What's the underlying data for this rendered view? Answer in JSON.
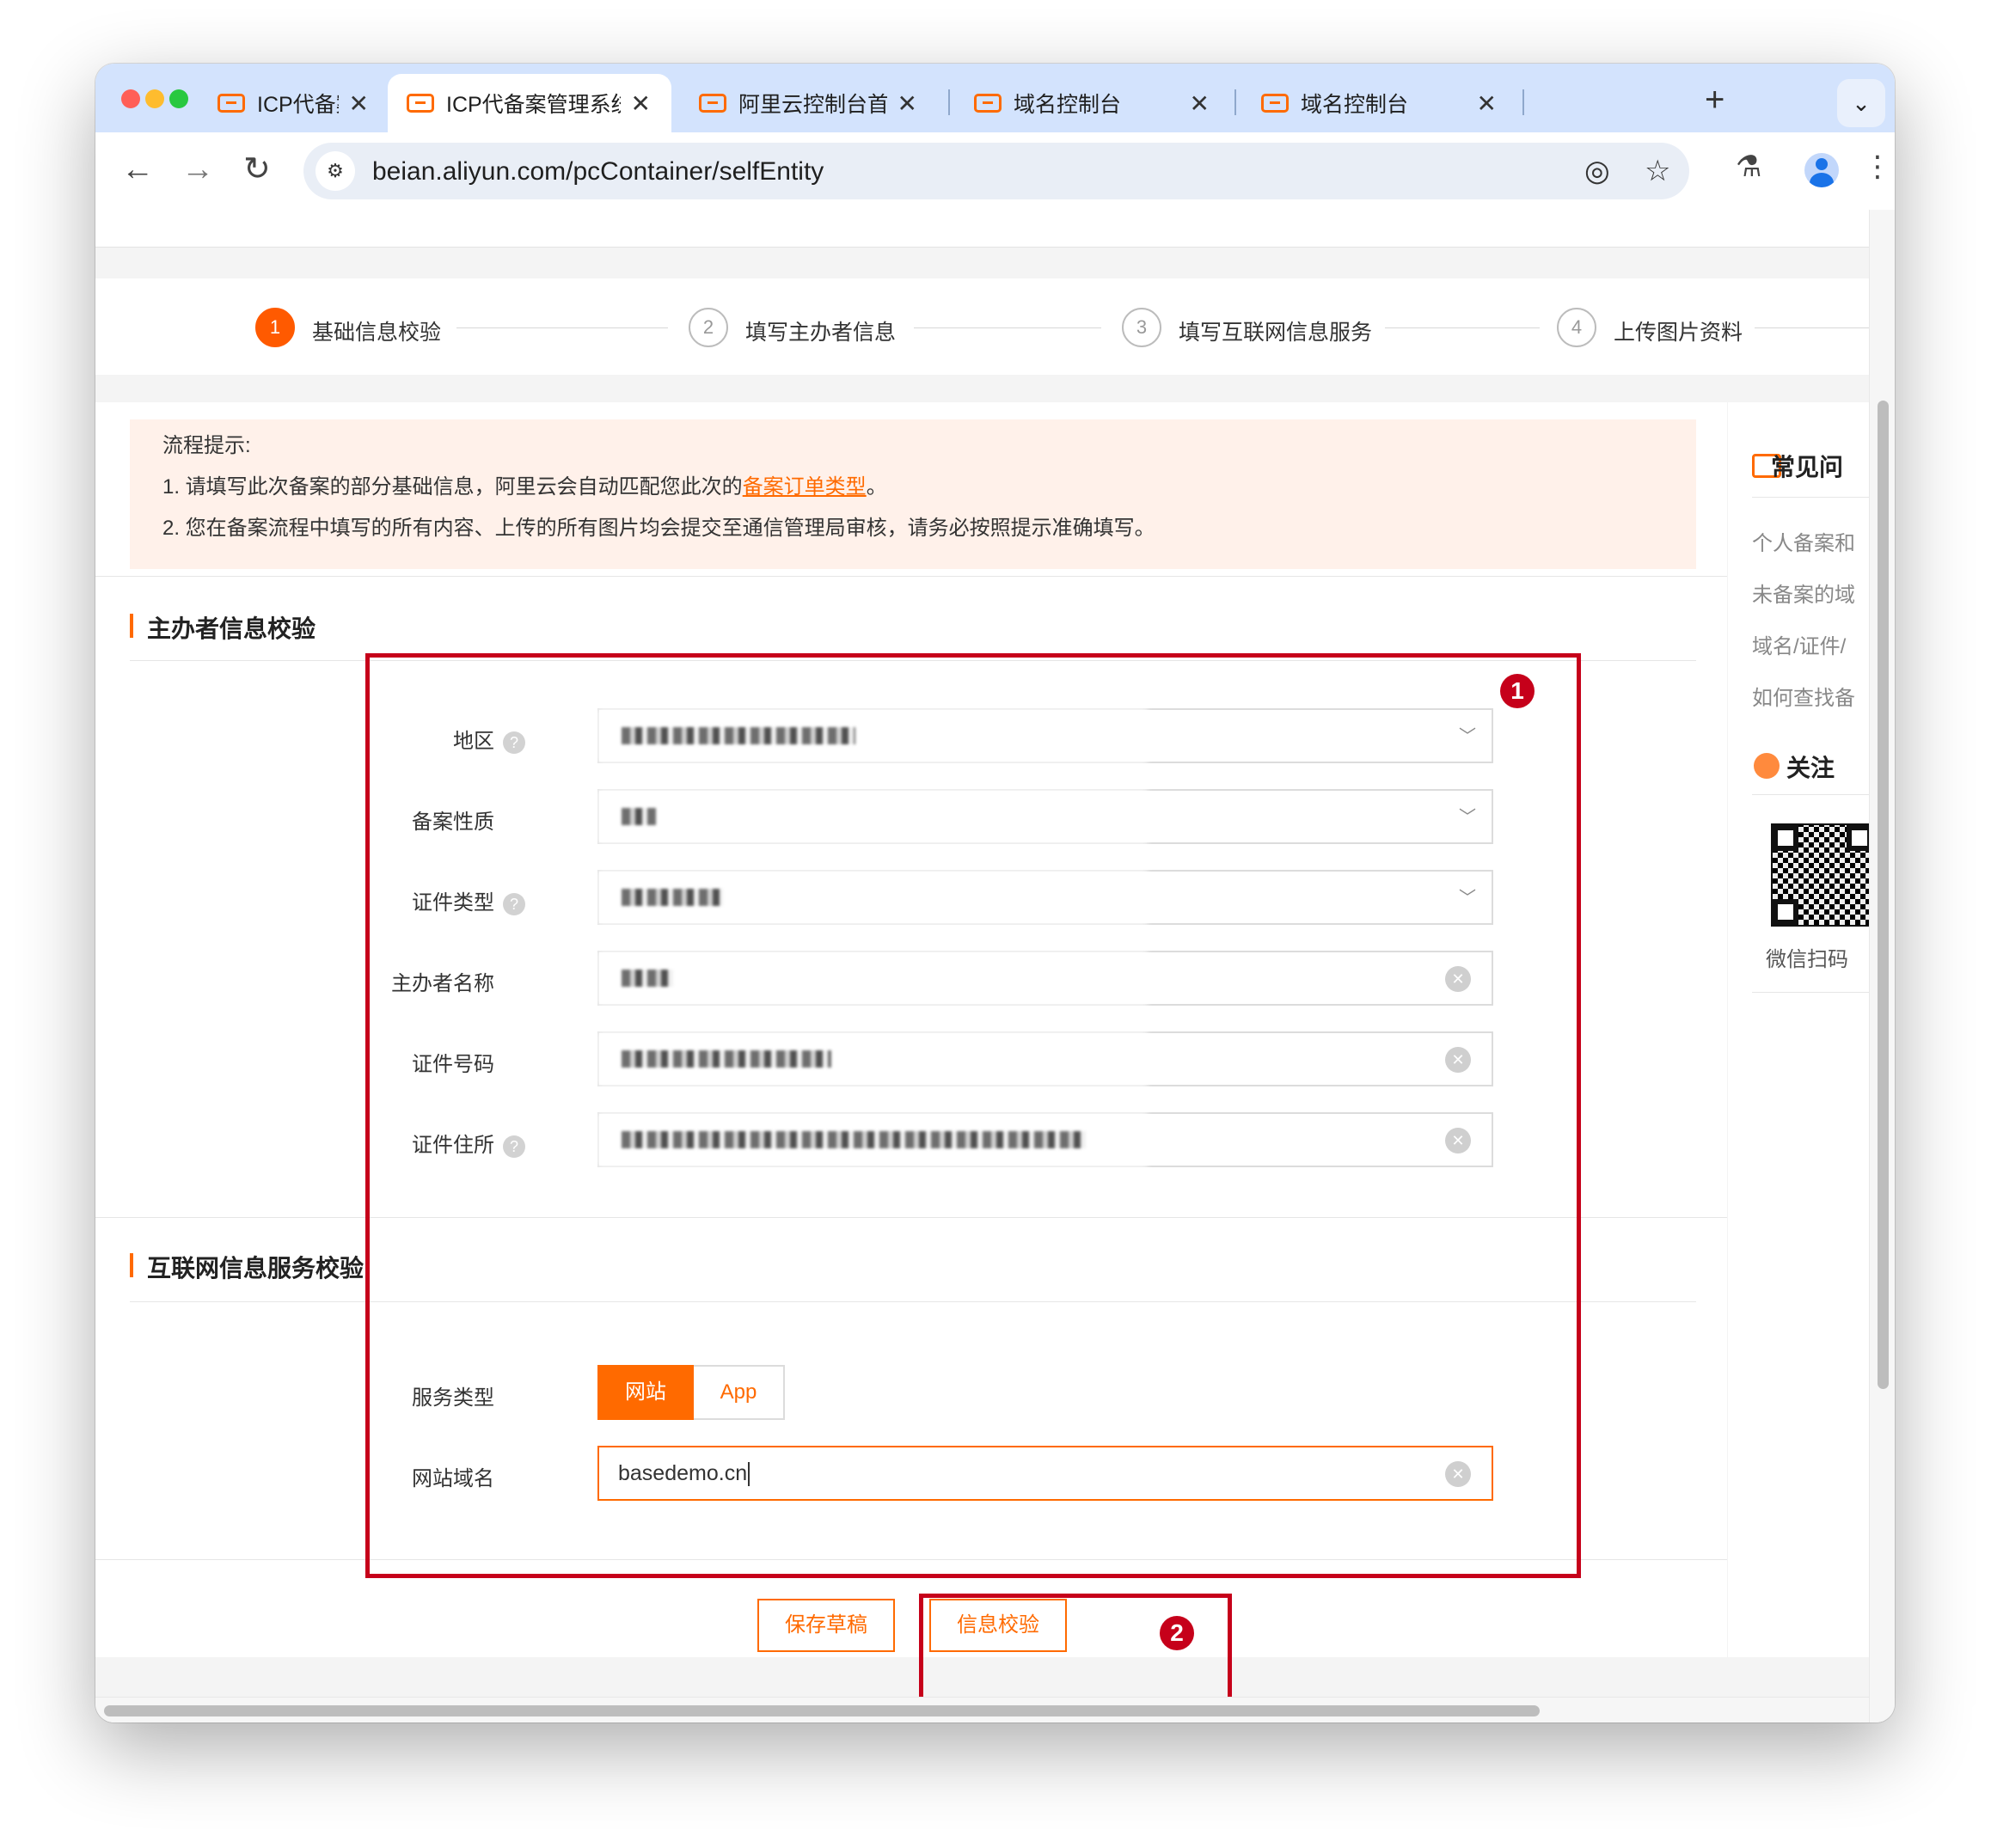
{
  "browser": {
    "tabs": [
      {
        "title": "ICP代备案管理系统"
      },
      {
        "title": "ICP代备案管理系统"
      },
      {
        "title": "阿里云控制台首页"
      },
      {
        "title": "域名控制台"
      },
      {
        "title": "域名控制台"
      }
    ],
    "url": "beian.aliyun.com/pcContainer/selfEntity"
  },
  "steps": [
    {
      "num": "1",
      "label": "基础信息校验"
    },
    {
      "num": "2",
      "label": "填写主办者信息"
    },
    {
      "num": "3",
      "label": "填写互联网信息服务"
    },
    {
      "num": "4",
      "label": "上传图片资料"
    }
  ],
  "notice": {
    "title": "流程提示:",
    "line1_prefix": "1. 请填写此次备案的部分基础信息，阿里云会自动匹配您此次的",
    "line1_link": "备案订单类型",
    "line1_suffix": "。",
    "line2": "2. 您在备案流程中填写的所有内容、上传的所有图片均会提交至通信管理局审核，请务必按照提示准确填写。"
  },
  "sponsor_section": {
    "title": "主办者信息校验",
    "fields": {
      "region": {
        "label": "地区"
      },
      "nature": {
        "label": "备案性质"
      },
      "cert_type": {
        "label": "证件类型"
      },
      "name": {
        "label": "主办者名称"
      },
      "cert_no": {
        "label": "证件号码"
      },
      "address": {
        "label": "证件住所"
      }
    }
  },
  "service_section": {
    "title": "互联网信息服务校验",
    "service_type_label": "服务类型",
    "service_type_options": [
      "网站",
      "App"
    ],
    "domain_label": "网站域名",
    "domain_value": "basedemo.cn"
  },
  "buttons": {
    "save_draft": "保存草稿",
    "verify": "信息校验"
  },
  "annotations": [
    "1",
    "2"
  ],
  "sidebar": {
    "faq_title": "常见问",
    "faq_items": [
      "个人备案和",
      "未备案的域",
      "域名/证件/",
      "如何查找备"
    ],
    "follow_title": "关注",
    "qr_caption": "微信扫码"
  },
  "colors": {
    "accent": "#ff6a00",
    "annotation": "#c6001a",
    "tabstrip": "#d3e3fd"
  }
}
